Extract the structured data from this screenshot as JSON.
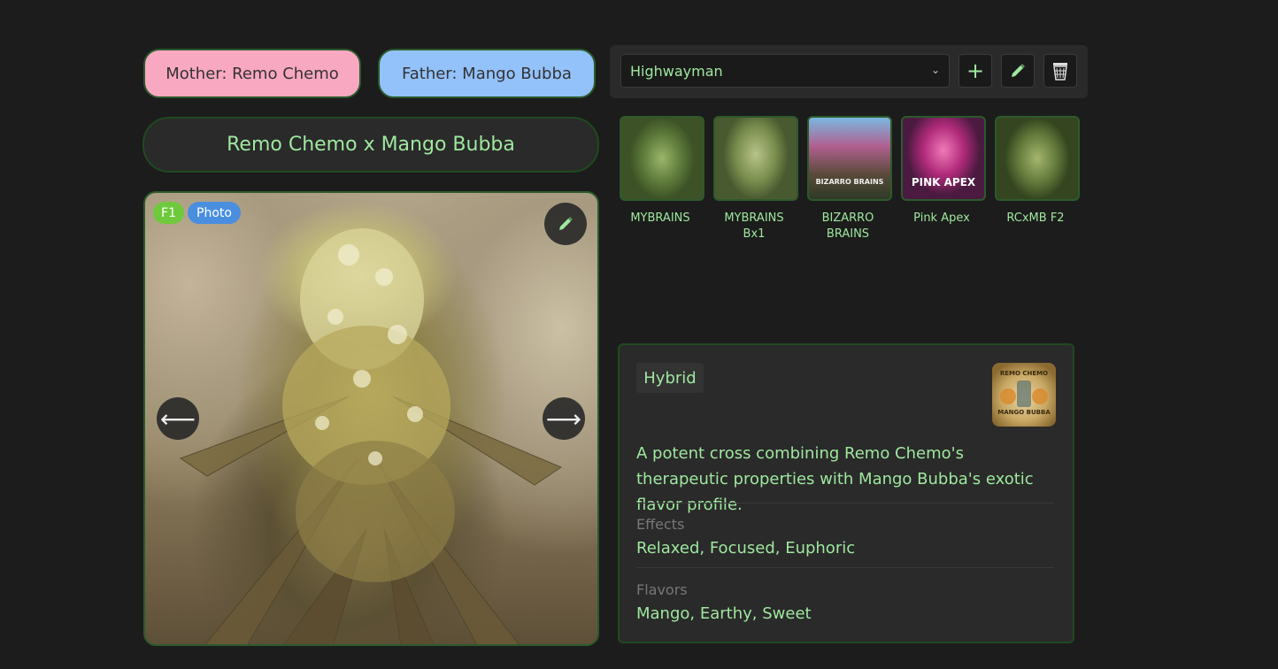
{
  "parents": {
    "mother_label": "Mother: Remo Chemo",
    "father_label": "Father: Mango Bubba"
  },
  "cross_title": "Remo Chemo x Mango Bubba",
  "photo": {
    "badges": [
      "F1",
      "Photo"
    ],
    "prev_arrow": "⟵",
    "next_arrow": "⟶"
  },
  "toolbar": {
    "selected_strain": "Highwayman",
    "add_label": "+"
  },
  "thumbnails": [
    {
      "label": "MYBRAINS"
    },
    {
      "label": "MYBRAINS Bx1"
    },
    {
      "label": "BIZARRO BRAINS",
      "overlay": "BIZARRO BRAINS"
    },
    {
      "label": "Pink Apex",
      "overlay": "PINK APEX"
    },
    {
      "label": "RCxMB F2"
    }
  ],
  "info": {
    "type": "Hybrid",
    "logo_top": "REMO CHEMO",
    "logo_bottom": "MANGO BUBBA",
    "description": "A potent cross combining Remo Chemo's therapeutic properties with Mango Bubba's exotic flavor profile.",
    "effects_label": "Effects",
    "effects_value": "Relaxed, Focused, Euphoric",
    "flavors_label": "Flavors",
    "flavors_value": "Mango, Earthy, Sweet"
  },
  "colors": {
    "accent_text": "#9fe89f",
    "mother_bg": "#f9a8c2",
    "father_bg": "#93c2fb",
    "f1_badge": "#6fc93d",
    "photo_badge": "#4a8ee0",
    "background": "#1c1c1c"
  },
  "icons": [
    "pencil-icon",
    "plus-icon",
    "trash-icon",
    "arrow-left-icon",
    "arrow-right-icon",
    "chevron-down-icon"
  ]
}
